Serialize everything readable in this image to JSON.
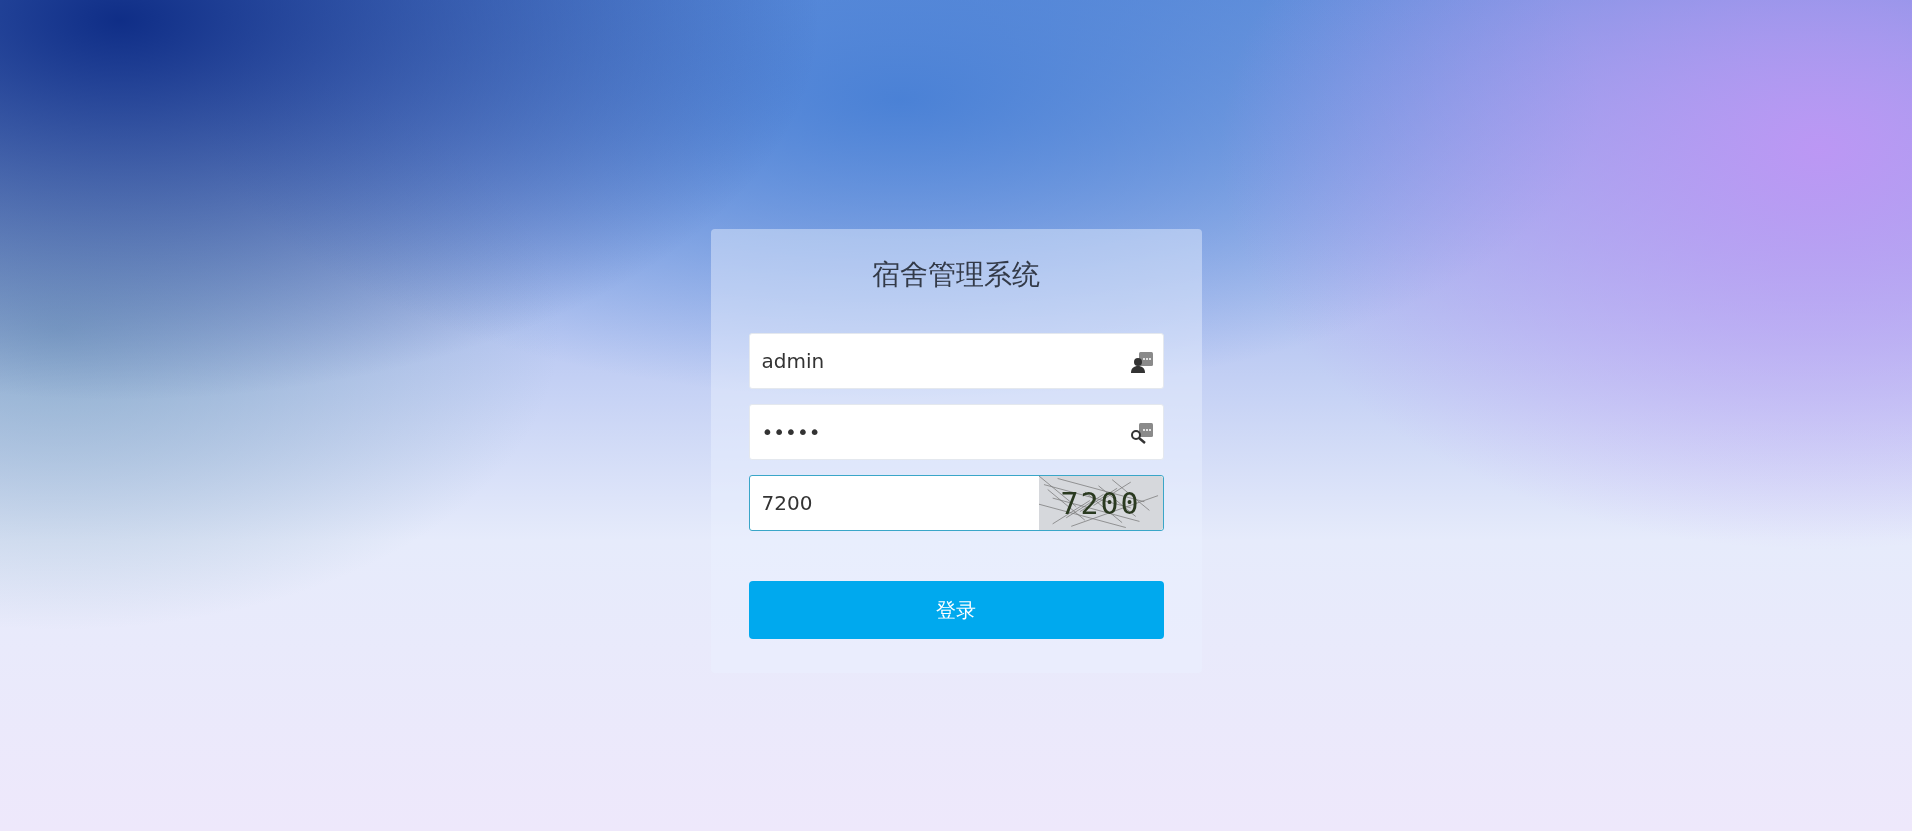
{
  "title": "宿舍管理系统",
  "fields": [
    {
      "kind": "user",
      "value": "admin",
      "focused": false
    },
    {
      "kind": "password",
      "value": "•••••",
      "focused": false
    },
    {
      "kind": "captcha",
      "value": "7200",
      "focused": true,
      "captcha_text": "7200"
    }
  ],
  "login_button": "登录"
}
